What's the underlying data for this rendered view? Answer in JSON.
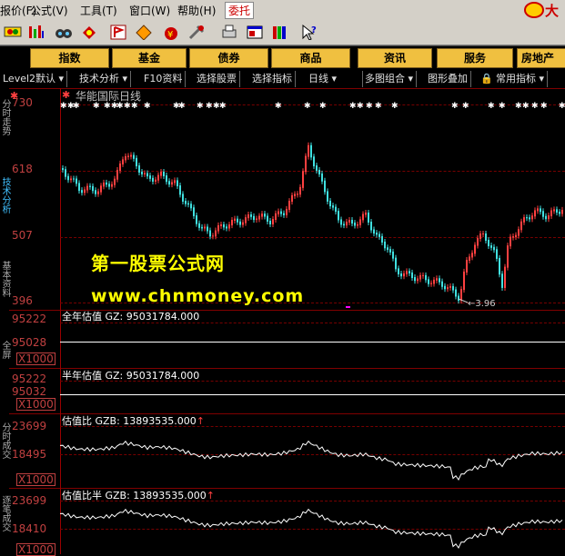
{
  "menu": {
    "items": [
      "报价(F)",
      "公式(V)",
      "工具(T)",
      "窗口(W)",
      "帮助(H)"
    ],
    "active_item": "委托",
    "logo_glyph": "大"
  },
  "categories": [
    "指数",
    "基金",
    "债券",
    "商品",
    "资讯",
    "服务",
    "房地产"
  ],
  "tabs": [
    "Level2默认",
    "技术分析",
    "F10资料",
    "选择股票",
    "选择指标",
    "日线",
    "多图组合",
    "图形叠加",
    "常用指标"
  ],
  "tab_dropdowns": [
    true,
    true,
    false,
    false,
    false,
    true,
    true,
    false,
    true
  ],
  "left_strip": [
    "分时走势",
    "技术分析",
    "基本资料",
    "全屏",
    "分时成交",
    "逐笔成交"
  ],
  "main_chart": {
    "title": "华能国际日线",
    "axis_labels": [
      "730",
      "618",
      "507",
      "396"
    ],
    "low_label": "3.96",
    "watermark_cn": "第一股票公式网",
    "watermark_url": "www.chnmoney.com"
  },
  "pane1": {
    "title": "全年估值 GZ: 95031784.000",
    "axis_labels": [
      "95222",
      "95028"
    ],
    "multiplier": "X1000"
  },
  "pane2": {
    "title": "半年估值 GZ: 95031784.000",
    "axis_labels": [
      "95222",
      "95032"
    ],
    "multiplier": "X1000"
  },
  "pane3": {
    "title": "估值比 GZB: 13893535.000",
    "axis_labels": [
      "23699",
      "18495"
    ],
    "multiplier": "X1000"
  },
  "pane4": {
    "title": "估值比半 GZB: 13893535.000",
    "axis_labels": [
      "23699",
      "18410"
    ],
    "multiplier": "X1000"
  },
  "colors": {
    "up_candle": "#ff4040",
    "down_candle": "#40e0e0",
    "grid": "#700000",
    "axis_text": "#c04040",
    "watermark": "#ffff00"
  }
}
